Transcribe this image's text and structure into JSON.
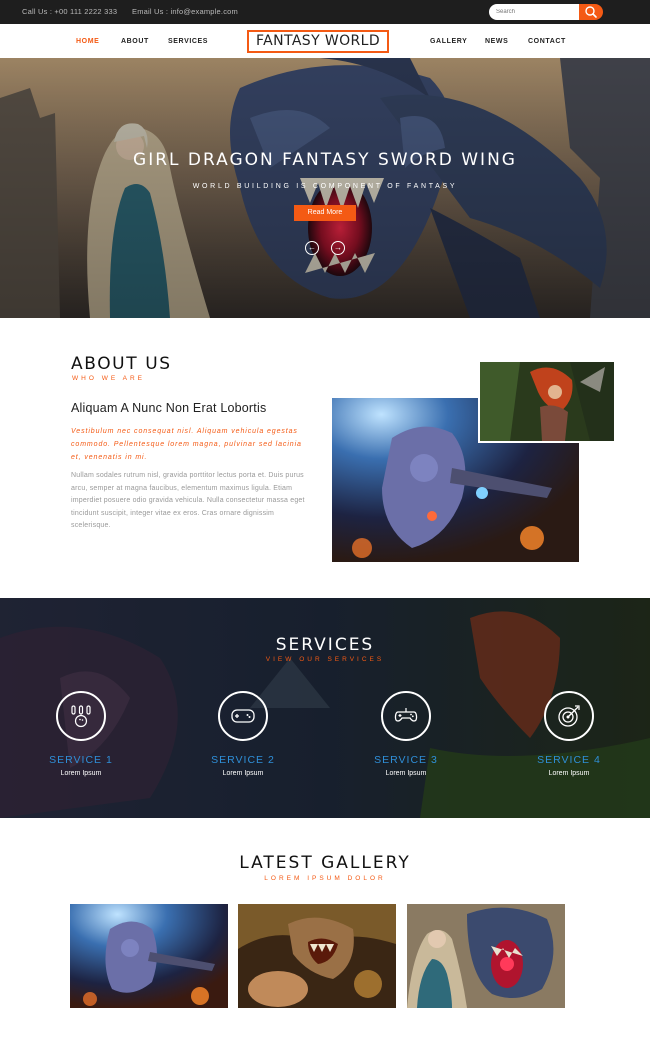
{
  "topbar": {
    "call": "Call Us : +00 111 2222 333",
    "email": "Email Us : info@example.com",
    "search_placeholder": "Search"
  },
  "nav": {
    "home": "HOME",
    "about": "ABOUT",
    "services": "SERVICES",
    "logo": "FANTASY WORLD",
    "gallery": "GALLERY",
    "news": "NEWS",
    "contact": "CONTACT"
  },
  "hero": {
    "title": "GIRL DRAGON FANTASY SWORD WING",
    "subtitle": "WORLD BUILDING IS COMPONENT OF FANTASY",
    "button": "Read More",
    "prev": "←",
    "next": "→"
  },
  "about": {
    "title": "ABOUT US",
    "subtitle": "WHO WE ARE",
    "heading": "Aliquam A Nunc Non Erat Lobortis",
    "italic": "Vestibulum nec consequat nisl. Aliquam vehicula egestas commodo. Pellentesque lorem magna, pulvinar sed lacinia et, venenatis in mi.",
    "body": "Nullam sodales rutrum nisl, gravida porttitor lectus porta et. Duis purus arcu, semper at magna faucibus, elementum maximus ligula. Etiam imperdiet posuere odio gravida vehicula. Nulla consectetur massa eget tincidunt suscipit, integer vitae ex eros. Cras ornare dignissim scelerisque."
  },
  "services": {
    "title": "SERVICES",
    "subtitle": "VIEW OUR SERVICES",
    "items": [
      {
        "name": "SERVICE 1",
        "desc": "Lorem Ipsum",
        "icon": "bowling-icon"
      },
      {
        "name": "SERVICE 2",
        "desc": "Lorem Ipsum",
        "icon": "gamepad-icon"
      },
      {
        "name": "SERVICE 3",
        "desc": "Lorem Ipsum",
        "icon": "controller-icon"
      },
      {
        "name": "SERVICE 4",
        "desc": "Lorem Ipsum",
        "icon": "target-icon"
      }
    ]
  },
  "gallery": {
    "title": "LATEST GALLERY",
    "subtitle": "LOREM IPSUM DOLOR"
  },
  "colors": {
    "accent": "#f45a14",
    "service_blue": "#2f8fd8",
    "topbar": "#1e1e1e"
  }
}
